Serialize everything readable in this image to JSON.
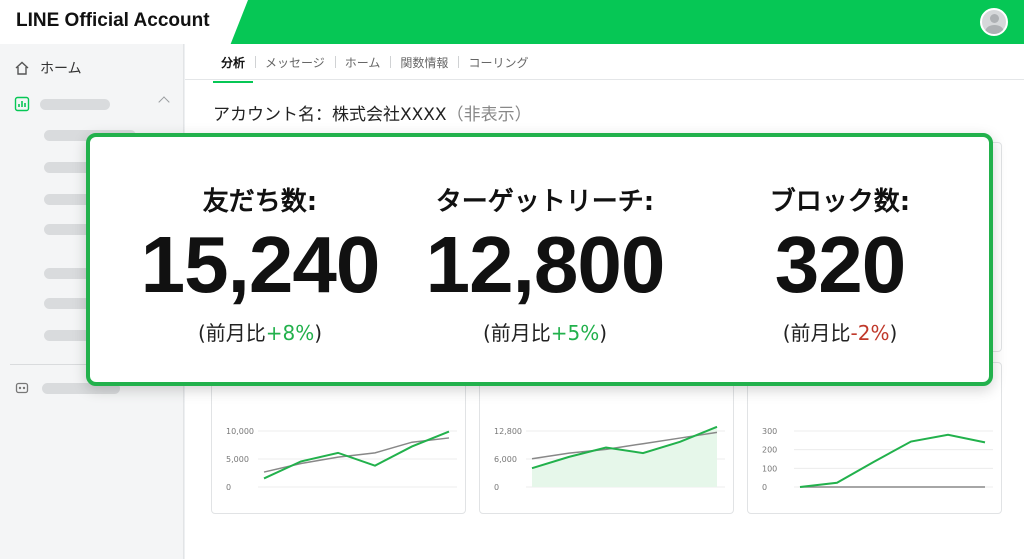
{
  "app": {
    "title": "LINE Official Account"
  },
  "colors": {
    "brand": "#06c755",
    "positive": "#22b14c",
    "negative": "#c0392b"
  },
  "sidebar": {
    "home_label": "ホーム",
    "home_icon": "home-icon",
    "analytics_icon": "bar-chart-icon",
    "bottom_icon": "robot-icon"
  },
  "tabs": [
    "分析",
    "メッセージ",
    "ホーム",
    "関数情報",
    "コーリング"
  ],
  "account": {
    "label": "アカウント名：株式会社XXXX",
    "suffix": "（非表示）"
  },
  "stats": [
    {
      "label": "友だち数:",
      "value": "15,240",
      "change_prefix": "(前月比",
      "change": "+8%",
      "change_suffix": ")"
    },
    {
      "label": "ターゲットリーチ:",
      "value": "12,800",
      "change_prefix": "(前月比",
      "change": "+5%",
      "change_suffix": ")"
    },
    {
      "label": "ブロック数:",
      "value": "320",
      "change_prefix": "(前月比",
      "change": "-2%",
      "change_suffix": ")"
    }
  ],
  "chart_data": [
    {
      "type": "line",
      "yticks": [
        "10,000",
        "5,000",
        "0"
      ],
      "ylim": [
        0,
        15000
      ],
      "series": [
        {
          "values": [
            2000,
            6000,
            8000,
            5000,
            9500,
            13000
          ],
          "color": "#22b14c"
        },
        {
          "values": [
            3500,
            5500,
            7000,
            8000,
            10500,
            11500
          ],
          "color": "#888888"
        }
      ]
    },
    {
      "type": "area",
      "yticks": [
        "12,800",
        "6,000",
        "0"
      ],
      "ylim": [
        0,
        17000
      ],
      "series": [
        {
          "values": [
            5000,
            8000,
            10500,
            9000,
            12000,
            16000
          ],
          "color": "#22b14c"
        },
        {
          "values": [
            7500,
            9000,
            10000,
            11500,
            13000,
            14500
          ],
          "color": "#888888"
        }
      ]
    },
    {
      "type": "line",
      "yticks": [
        "300",
        "200",
        "100",
        "0"
      ],
      "ylim": [
        0,
        380
      ],
      "series": [
        {
          "values": [
            0,
            25,
            150,
            270,
            310,
            265
          ],
          "color": "#22b14c"
        },
        {
          "values": [
            0,
            0,
            0,
            0,
            0,
            0
          ],
          "color": "#888888"
        }
      ]
    }
  ]
}
